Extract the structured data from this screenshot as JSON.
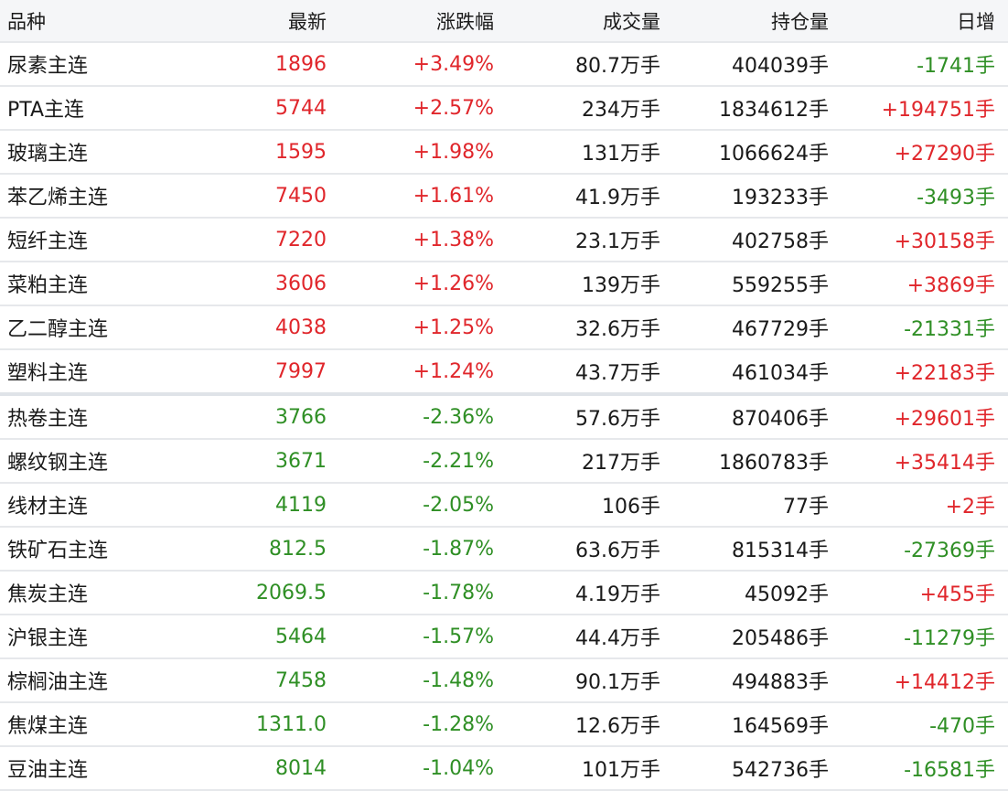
{
  "colors": {
    "up": "#e0262b",
    "down": "#2f8f25",
    "header_bg": "#f5f6f8",
    "border": "#e6e8eb"
  },
  "columns": {
    "name": "品种",
    "latest": "最新",
    "change": "涨跌幅",
    "volume": "成交量",
    "open_interest": "持仓量",
    "daily_change": "日增"
  },
  "rows": [
    {
      "name": "尿素主连",
      "latest": "1896",
      "change": "+3.49%",
      "volume": "80.7万手",
      "open_interest": "404039手",
      "daily_change": "-1741手",
      "price_dir": "up",
      "daily_dir": "down"
    },
    {
      "name": "PTA主连",
      "latest": "5744",
      "change": "+2.57%",
      "volume": "234万手",
      "open_interest": "1834612手",
      "daily_change": "+194751手",
      "price_dir": "up",
      "daily_dir": "up"
    },
    {
      "name": "玻璃主连",
      "latest": "1595",
      "change": "+1.98%",
      "volume": "131万手",
      "open_interest": "1066624手",
      "daily_change": "+27290手",
      "price_dir": "up",
      "daily_dir": "up"
    },
    {
      "name": "苯乙烯主连",
      "latest": "7450",
      "change": "+1.61%",
      "volume": "41.9万手",
      "open_interest": "193233手",
      "daily_change": "-3493手",
      "price_dir": "up",
      "daily_dir": "down"
    },
    {
      "name": "短纤主连",
      "latest": "7220",
      "change": "+1.38%",
      "volume": "23.1万手",
      "open_interest": "402758手",
      "daily_change": "+30158手",
      "price_dir": "up",
      "daily_dir": "up"
    },
    {
      "name": "菜粕主连",
      "latest": "3606",
      "change": "+1.26%",
      "volume": "139万手",
      "open_interest": "559255手",
      "daily_change": "+3869手",
      "price_dir": "up",
      "daily_dir": "up"
    },
    {
      "name": "乙二醇主连",
      "latest": "4038",
      "change": "+1.25%",
      "volume": "32.6万手",
      "open_interest": "467729手",
      "daily_change": "-21331手",
      "price_dir": "up",
      "daily_dir": "down"
    },
    {
      "name": "塑料主连",
      "latest": "7997",
      "change": "+1.24%",
      "volume": "43.7万手",
      "open_interest": "461034手",
      "daily_change": "+22183手",
      "price_dir": "up",
      "daily_dir": "up"
    },
    {
      "name": "热卷主连",
      "latest": "3766",
      "change": "-2.36%",
      "volume": "57.6万手",
      "open_interest": "870406手",
      "daily_change": "+29601手",
      "price_dir": "down",
      "daily_dir": "up"
    },
    {
      "name": "螺纹钢主连",
      "latest": "3671",
      "change": "-2.21%",
      "volume": "217万手",
      "open_interest": "1860783手",
      "daily_change": "+35414手",
      "price_dir": "down",
      "daily_dir": "up"
    },
    {
      "name": "线材主连",
      "latest": "4119",
      "change": "-2.05%",
      "volume": "106手",
      "open_interest": "77手",
      "daily_change": "+2手",
      "price_dir": "down",
      "daily_dir": "up"
    },
    {
      "name": "铁矿石主连",
      "latest": "812.5",
      "change": "-1.87%",
      "volume": "63.6万手",
      "open_interest": "815314手",
      "daily_change": "-27369手",
      "price_dir": "down",
      "daily_dir": "down"
    },
    {
      "name": "焦炭主连",
      "latest": "2069.5",
      "change": "-1.78%",
      "volume": "4.19万手",
      "open_interest": "45092手",
      "daily_change": "+455手",
      "price_dir": "down",
      "daily_dir": "up"
    },
    {
      "name": "沪银主连",
      "latest": "5464",
      "change": "-1.57%",
      "volume": "44.4万手",
      "open_interest": "205486手",
      "daily_change": "-11279手",
      "price_dir": "down",
      "daily_dir": "down"
    },
    {
      "name": "棕榈油主连",
      "latest": "7458",
      "change": "-1.48%",
      "volume": "90.1万手",
      "open_interest": "494883手",
      "daily_change": "+14412手",
      "price_dir": "down",
      "daily_dir": "up"
    },
    {
      "name": "焦煤主连",
      "latest": "1311.0",
      "change": "-1.28%",
      "volume": "12.6万手",
      "open_interest": "164569手",
      "daily_change": "-470手",
      "price_dir": "down",
      "daily_dir": "down"
    },
    {
      "name": "豆油主连",
      "latest": "8014",
      "change": "-1.04%",
      "volume": "101万手",
      "open_interest": "542736手",
      "daily_change": "-16581手",
      "price_dir": "down",
      "daily_dir": "down"
    }
  ]
}
